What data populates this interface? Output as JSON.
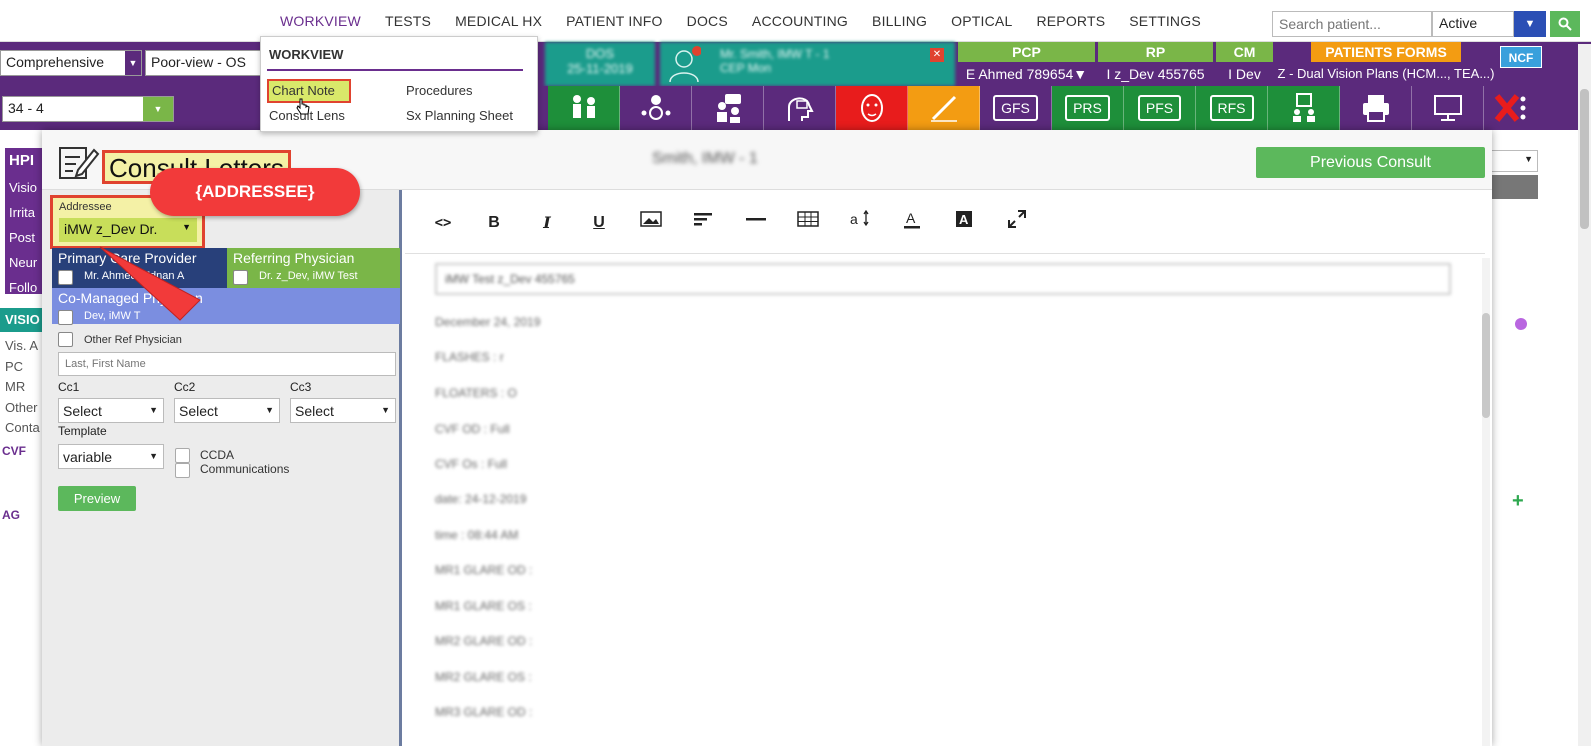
{
  "topnav": {
    "items": [
      "WORKVIEW",
      "TESTS",
      "MEDICAL HX",
      "PATIENT INFO",
      "DOCS",
      "ACCOUNTING",
      "BILLING",
      "OPTICAL",
      "REPORTS",
      "SETTINGS"
    ],
    "search_placeholder": "Search patient...",
    "status_value": "Active"
  },
  "header": {
    "exam_type": "Comprehensive",
    "view_select": "Poor-view - OS",
    "visit_select": "34 - 4",
    "dos_label": "DOS",
    "dos_value": "25-11-2019",
    "patient_line1": "Mr. Smith, IMW T - 1",
    "patient_line2": "CEP Mon",
    "pcp_label": "PCP",
    "pcp_value": "E Ahmed 789654▼",
    "rp_label": "RP",
    "rp_value": "I z_Dev 455765",
    "cm_label": "CM",
    "cm_value": "I Dev",
    "forms_label": "PATIENTS FORMS",
    "forms_value": "Z - Dual Vision Plans (HCM..., TEA...)",
    "ncf": "NCF"
  },
  "icon_bar": {
    "labels": [
      "GFS",
      "PRS",
      "PFS",
      "RFS"
    ]
  },
  "workview_menu": {
    "title": "WORKVIEW",
    "items": [
      "Chart Note",
      "Procedures",
      "Consult Lens",
      "Sx Planning Sheet"
    ]
  },
  "left_panel": {
    "hpi": "HPI",
    "hpi_items": [
      "Visio",
      "Irrita",
      "Post",
      "Neur",
      "Follo"
    ],
    "vision": "VISIO",
    "vision_items": [
      "Vis. A",
      "PC",
      "MR",
      "Other",
      "Conta"
    ],
    "cvf": "CVF",
    "ag": "AG"
  },
  "modal": {
    "title": "Consult Letters",
    "patient_name": "Smith, IMW - 1",
    "previous_consult": "Previous Consult"
  },
  "form": {
    "addressee_label": "Addressee",
    "addressee_value": "iMW z_Dev Dr.",
    "pcp_title": "Primary Care Provider",
    "pcp_name": "Mr. Ahmed, Ednan A",
    "rp_title": "Referring Physician",
    "rp_name": "Dr. z_Dev, iMW Test",
    "cm_title": "Co-Managed Physician",
    "cm_name": "Dev, iMW T",
    "other_label": "Other Ref Physician",
    "name_placeholder": "Last, First Name",
    "cc1": "Cc1",
    "cc2": "Cc2",
    "cc3": "Cc3",
    "select": "Select",
    "template_label": "Template",
    "template_value": "variable",
    "ccda": "CCDA",
    "communications": "Communications",
    "preview": "Preview"
  },
  "callout": {
    "text": "{ADDRESSEE}",
    "color": "#f23a3a"
  },
  "editor": {
    "toolbar": [
      "<>",
      "B",
      "I",
      "U",
      "image-icon",
      "align-icon",
      "hr-icon",
      "table-icon",
      "font-size-icon",
      "font-color-icon",
      "bg-color-icon",
      "fullscreen-icon"
    ],
    "first_line": "iMW Test z_Dev 455765",
    "lines": [
      "December 24, 2019",
      "FLASHES : r",
      "FLOATERS : O",
      "CVF OD : Full",
      "CVF Os : Full",
      "date: 24-12-2019",
      "time : 08:44 AM",
      "MR1 GLARE OD :",
      "MR1 GLARE OS :",
      "MR2 GLARE OD :",
      "MR2 GLARE OS :",
      "MR3 GLARE OD :"
    ]
  },
  "colors": {
    "purple": "#5b2a7c",
    "teal": "#1b9c8c",
    "green": "#7ab648",
    "highlight": "#f4f1a6",
    "red_outline": "#e0432f"
  }
}
